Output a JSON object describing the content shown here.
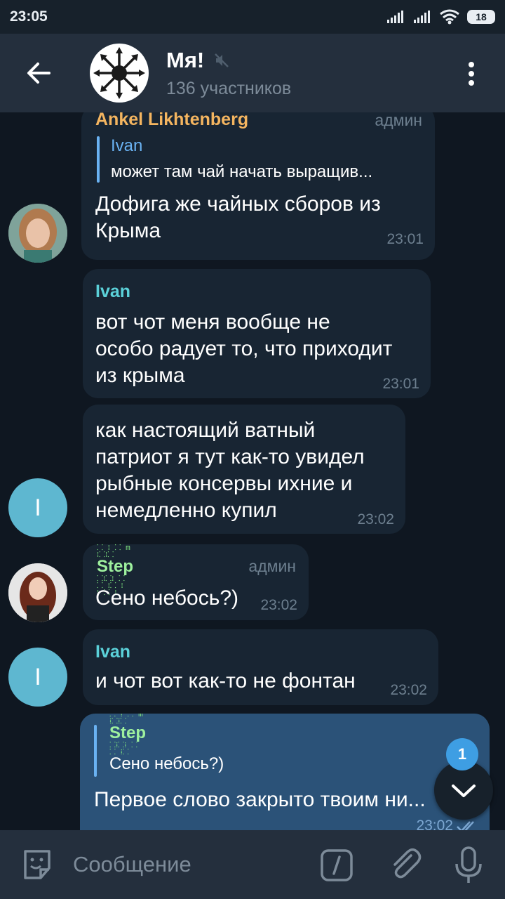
{
  "status_bar": {
    "time": "23:05",
    "battery": "18"
  },
  "header": {
    "title": "Мя!",
    "subtitle": "136 участников"
  },
  "messages": [
    {
      "sender": "Ankel Likhtenberg",
      "role": "админ",
      "reply": {
        "name": "Ivan",
        "text": "может там чай начать выращив..."
      },
      "text": "Дофига же чайных сборов из\nКрыма",
      "time": "23:01"
    },
    {
      "sender": "Ivan",
      "text": "вот чот меня вообще не\nособо радует то, что приходит\nиз крыма",
      "time": "23:01"
    },
    {
      "text": "как настоящий ватный\nпатриот я тут как-то увидел\nрыбные консервы ихние и\nнемедленно купил",
      "time": "23:02",
      "avatar_letter": "I"
    },
    {
      "sender_logo": "Step",
      "role": "админ",
      "text": "Сено небось?)",
      "time": "23:02"
    },
    {
      "sender": "Ivan",
      "text": "и чот вот как-то не фонтан",
      "time": "23:02",
      "avatar_letter": "I"
    },
    {
      "reply": {
        "name": "Step",
        "text": "Сено небось?)"
      },
      "text": "Первое слово закрыто твоим ни...",
      "time": "23:02"
    }
  ],
  "scroll_badge": "1",
  "input": {
    "placeholder": "Сообщение"
  },
  "colors": {
    "background": "#0f1721",
    "header": "#242f3d",
    "incoming_bubble": "#182533",
    "outgoing_bubble": "#2b5278",
    "accent": "#5bd1d9",
    "admin_name": "#f4b560"
  }
}
